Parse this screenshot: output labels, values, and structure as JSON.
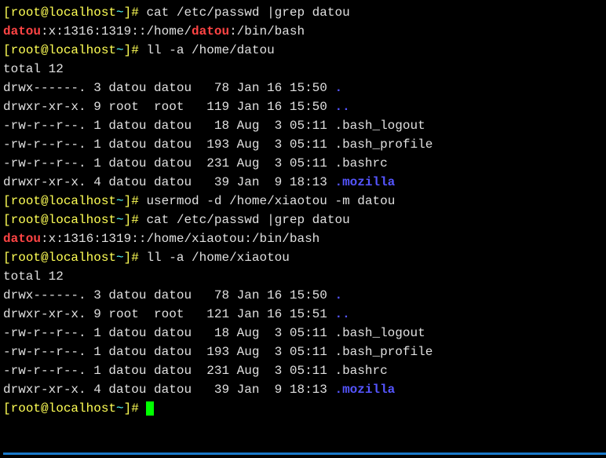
{
  "prompt": {
    "open": "[",
    "user_host": "root@localhost",
    "cwd": "~",
    "close": "]#"
  },
  "cmd1": " cat /etc/passwd |grep datou",
  "grep1": {
    "match": "datou",
    "rest": ":x:1316:1319::/home/",
    "match2": "datou",
    "rest2": ":/bin/bash"
  },
  "cmd2": " ll -a /home/datou",
  "total1": "total 12",
  "ls1": [
    {
      "perm": "drwx------.",
      "n": "3",
      "u": "datou",
      "g": "datou",
      "size": "  78",
      "date": "Jan 16 15:50",
      "name": ".",
      "c": "blue"
    },
    {
      "perm": "drwxr-xr-x.",
      "n": "9",
      "u": "root ",
      "g": "root ",
      "size": " 119",
      "date": "Jan 16 15:50",
      "name": "..",
      "c": "blue"
    },
    {
      "perm": "-rw-r--r--.",
      "n": "1",
      "u": "datou",
      "g": "datou",
      "size": "  18",
      "date": "Aug  3 05:11",
      "name": ".bash_logout",
      "c": "white"
    },
    {
      "perm": "-rw-r--r--.",
      "n": "1",
      "u": "datou",
      "g": "datou",
      "size": " 193",
      "date": "Aug  3 05:11",
      "name": ".bash_profile",
      "c": "white"
    },
    {
      "perm": "-rw-r--r--.",
      "n": "1",
      "u": "datou",
      "g": "datou",
      "size": " 231",
      "date": "Aug  3 05:11",
      "name": ".bashrc",
      "c": "white"
    },
    {
      "perm": "drwxr-xr-x.",
      "n": "4",
      "u": "datou",
      "g": "datou",
      "size": "  39",
      "date": "Jan  9 18:13",
      "name": ".mozilla",
      "c": "blue"
    }
  ],
  "cmd3": " usermod -d /home/xiaotou -m datou",
  "cmd4": " cat /etc/passwd |grep datou",
  "grep2": {
    "match": "datou",
    "rest": ":x:1316:1319::/home/xiaotou:/bin/bash"
  },
  "cmd5": " ll -a /home/xiaotou",
  "total2": "total 12",
  "ls2": [
    {
      "perm": "drwx------.",
      "n": "3",
      "u": "datou",
      "g": "datou",
      "size": "  78",
      "date": "Jan 16 15:50",
      "name": ".",
      "c": "blue"
    },
    {
      "perm": "drwxr-xr-x.",
      "n": "9",
      "u": "root ",
      "g": "root ",
      "size": " 121",
      "date": "Jan 16 15:51",
      "name": "..",
      "c": "blue"
    },
    {
      "perm": "-rw-r--r--.",
      "n": "1",
      "u": "datou",
      "g": "datou",
      "size": "  18",
      "date": "Aug  3 05:11",
      "name": ".bash_logout",
      "c": "white"
    },
    {
      "perm": "-rw-r--r--.",
      "n": "1",
      "u": "datou",
      "g": "datou",
      "size": " 193",
      "date": "Aug  3 05:11",
      "name": ".bash_profile",
      "c": "white"
    },
    {
      "perm": "-rw-r--r--.",
      "n": "1",
      "u": "datou",
      "g": "datou",
      "size": " 231",
      "date": "Aug  3 05:11",
      "name": ".bashrc",
      "c": "white"
    },
    {
      "perm": "drwxr-xr-x.",
      "n": "4",
      "u": "datou",
      "g": "datou",
      "size": "  39",
      "date": "Jan  9 18:13",
      "name": ".mozilla",
      "c": "blue"
    }
  ]
}
